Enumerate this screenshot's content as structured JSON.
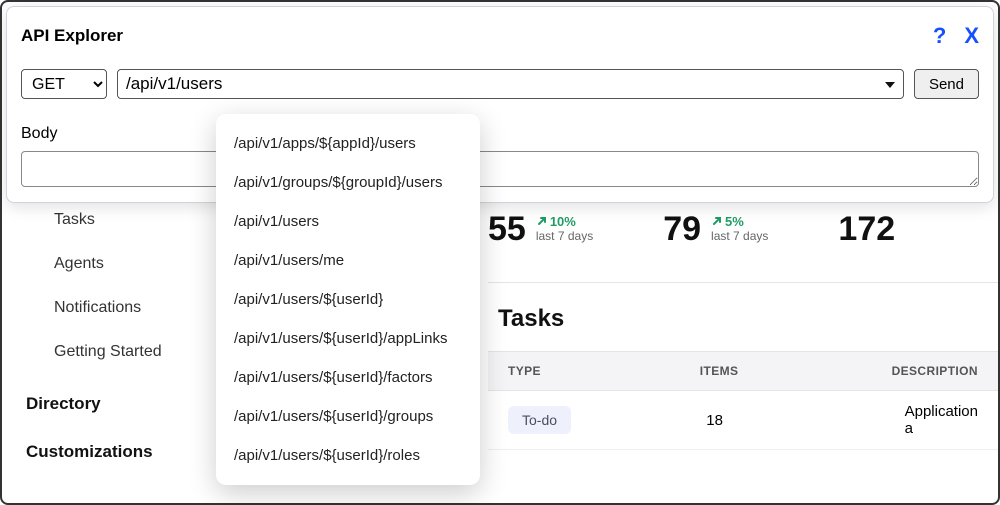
{
  "api_explorer": {
    "title": "API Explorer",
    "method": "GET",
    "url_value": "/api/v1/users",
    "send_label": "Send",
    "body_label": "Body",
    "body_value": ""
  },
  "dropdown": {
    "options": [
      "/api/v1/apps/${appId}/users",
      "/api/v1/groups/${groupId}/users",
      "/api/v1/users",
      "/api/v1/users/me",
      "/api/v1/users/${userId}",
      "/api/v1/users/${userId}/appLinks",
      "/api/v1/users/${userId}/factors",
      "/api/v1/users/${userId}/groups",
      "/api/v1/users/${userId}/roles"
    ]
  },
  "sidebar": {
    "items": [
      "Tasks",
      "Agents",
      "Notifications",
      "Getting Started"
    ],
    "sections": [
      "Directory",
      "Customizations"
    ]
  },
  "metrics": [
    {
      "value": "55",
      "delta": "10%",
      "period": "last 7 days"
    },
    {
      "value": "79",
      "delta": "5%",
      "period": "last 7 days"
    },
    {
      "value": "172"
    }
  ],
  "tasks": {
    "title": "Tasks",
    "columns": {
      "type": "TYPE",
      "items": "ITEMS",
      "desc": "DESCRIPTION"
    },
    "rows": [
      {
        "type": "To-do",
        "items": "18",
        "desc": "Application a"
      }
    ]
  }
}
